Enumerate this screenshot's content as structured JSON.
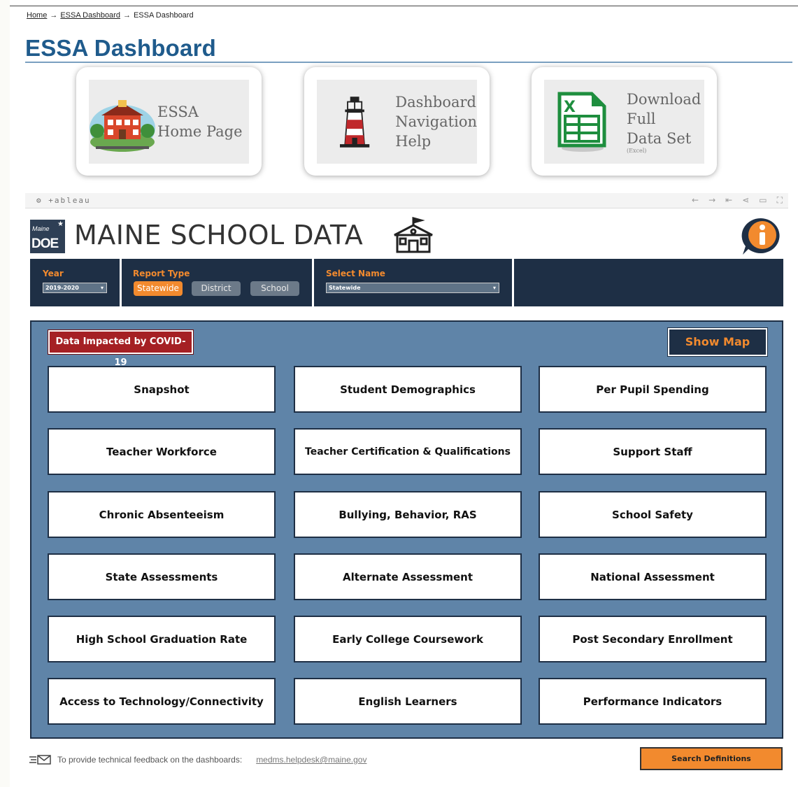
{
  "breadcrumb": {
    "home": "Home",
    "sep1": "→",
    "essa_link": "ESSA Dashboard",
    "sep2": "→",
    "current": "ESSA Dashboard"
  },
  "page_title": "ESSA Dashboard",
  "cards": [
    {
      "line1": "ESSA",
      "line2": "Home Page",
      "icon": "school-building-icon"
    },
    {
      "line1": "Dashboard",
      "line2": "Navigation",
      "line3": "Help",
      "icon": "lighthouse-icon"
    },
    {
      "line1": "Download",
      "line2": "Full",
      "line3": "Data Set",
      "note": "(Excel)",
      "icon": "excel-icon"
    }
  ],
  "tableau": {
    "logo": "+ableau",
    "tools": [
      "←",
      "→",
      "⇤",
      "⋖",
      "▭",
      "⛶"
    ]
  },
  "brand": {
    "logo_line1": "Maine",
    "logo_line2": "DOE",
    "title": "MAINE SCHOOL DATA"
  },
  "filters": {
    "year_label": "Year",
    "year_value": "2019-2020",
    "report_type_label": "Report Type",
    "report_types": [
      "Statewide",
      "District",
      "School"
    ],
    "report_type_selected": "Statewide",
    "select_name_label": "Select Name",
    "select_name_value": "Statewide"
  },
  "panel": {
    "covid_button": "Data Impacted by COVID-19",
    "map_button": "Show Map",
    "tiles": [
      "Snapshot",
      "Student Demographics",
      "Per Pupil Spending",
      "Teacher Workforce",
      "Teacher Certification & Qualifications",
      "Support Staff",
      "Chronic Absenteeism",
      "Bullying, Behavior, RAS",
      "School Safety",
      "State Assessments",
      "Alternate Assessment",
      "National Assessment",
      "High School Graduation Rate",
      "Early College Coursework",
      "Post Secondary Enrollment",
      "Access to Technology/Connectivity",
      "English Learners",
      "Performance Indicators"
    ]
  },
  "footer": {
    "feedback_text": "To provide technical feedback on the dashboards:",
    "email": "medms.helpdesk@maine.gov",
    "search_button": "Search Definitions"
  },
  "colors": {
    "navy": "#1e2f45",
    "orange": "#f28a2e",
    "panel_blue": "#5f84a8",
    "covid_red": "#a52024",
    "title_blue": "#1f5b8c"
  }
}
